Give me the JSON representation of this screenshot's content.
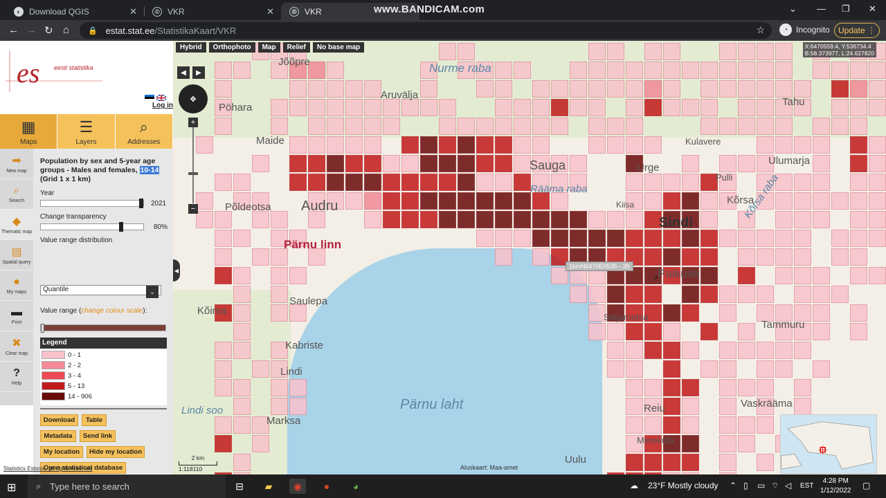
{
  "browser": {
    "tabs": [
      {
        "title": "Download QGIS"
      },
      {
        "title": "VKR"
      },
      {
        "title": "VKR"
      }
    ],
    "watermark": "www.BANDICAM.com",
    "url_host": "estat.stat.ee",
    "url_path": "/StatistikaKaart/VKR",
    "profile": "Incognito",
    "update_label": "Update"
  },
  "sidebar": {
    "logo_text": "eesti statistika",
    "login": "Log in",
    "main_tabs": [
      "Maps",
      "Layers",
      "Addresses"
    ],
    "tools": [
      "New map",
      "Search",
      "Thematic map",
      "Spatial query",
      "My maps",
      "Print",
      "Clear map",
      "Help"
    ],
    "title_prefix": "Population by sex and 5-year age groups - Males and females,",
    "title_highlight": "10-14",
    "title_suffix": "(Grid 1 x 1 km)",
    "year_label": "Year",
    "year_value": "2021",
    "transparency_label": "Change transparency",
    "transparency_value": "80%",
    "distribution_label": "Value range distribution",
    "distribution_value": "Quantile",
    "range_label": "Value range (",
    "range_link": "change colour scale",
    "range_label_end": "):",
    "legend_title": "Legend",
    "legend": [
      {
        "label": "0 - 1",
        "color": "#f9c2cb"
      },
      {
        "label": "2 - 2",
        "color": "#f28a98"
      },
      {
        "label": "3 - 4",
        "color": "#ee4a55"
      },
      {
        "label": "5 - 13",
        "color": "#c11a1a"
      },
      {
        "label": "14 - 906",
        "color": "#6a0b0b"
      }
    ],
    "buttons": [
      "Download",
      "Table",
      "Metadata",
      "Send link",
      "My location",
      "Hide my location",
      "Open statistical database"
    ],
    "footer": "Statistics Estonia, all rights reserved"
  },
  "map": {
    "basemaps": [
      "Hybrid",
      "Orthophoto",
      "Map",
      "Relief",
      "No base map"
    ],
    "coords_line1": "X:6470559.4, Y:536734.4",
    "coords_line2": "B:58.373977, L:24.627820",
    "tooltip": "1kmN6470E0536 - 39",
    "scale_label": "2 km",
    "scale_ratio": "1:118110",
    "attribution": "Aluskaart: Maa-amet",
    "places": [
      "Jõõpre",
      "Nurme raba",
      "Pöhara",
      "Maide",
      "Aruvälja",
      "Audru",
      "Põldeotsa",
      "Pärnu linn",
      "Saulepa",
      "Kõima",
      "Kabriste",
      "Lindi",
      "Lindi soo",
      "Marksa",
      "Pärnu laht",
      "Sauga",
      "Rääma raba",
      "Urge",
      "Kiisa",
      "Sindi",
      "Paikuse",
      "Tammuru",
      "Vaskrääma",
      "Reiu",
      "Merekula",
      "Uulu",
      "Tahu",
      "Kulavere",
      "Ulumarja",
      "Kõrsa raba",
      "Kõrsa",
      "Pulli",
      "Seljametsa"
    ]
  },
  "taskbar": {
    "search_placeholder": "Type here to search",
    "weather": "23°F  Mostly cloudy",
    "lang": "EST",
    "time": "4:28 PM",
    "date": "1/12/2022"
  }
}
